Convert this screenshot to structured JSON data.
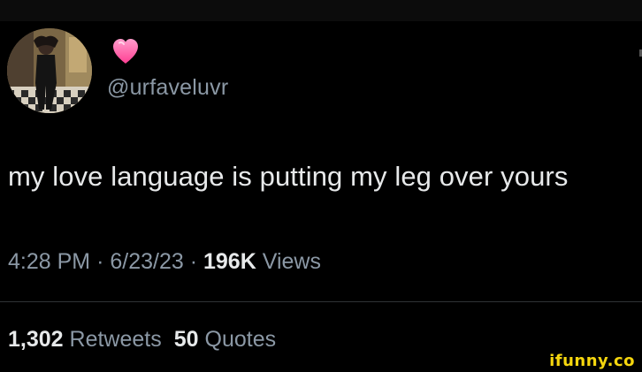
{
  "tweet": {
    "handle": "@urfaveluvr",
    "display_name_emoji": "heart-emoji",
    "text": "my love language is putting my leg over yours",
    "time": "4:28 PM",
    "date": "6/23/23",
    "separator": "·",
    "views_count": "196K",
    "views_label": "Views"
  },
  "stats": {
    "retweets_count": "1,302",
    "retweets_label": "Retweets",
    "quotes_count": "50",
    "quotes_label": "Quotes"
  },
  "watermark": {
    "text": "ifunny.co"
  },
  "colors": {
    "background": "#000000",
    "primary_text": "#e7e9ea",
    "secondary_text": "#8b98a5",
    "divider": "#2f3336",
    "heart": "#ff5ca8",
    "watermark": "#f5d60e"
  }
}
